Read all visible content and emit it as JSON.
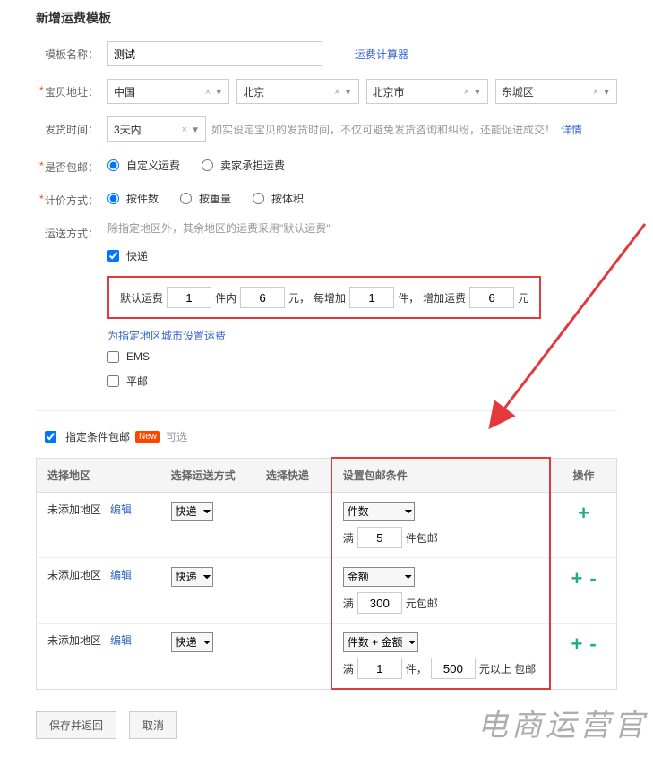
{
  "title": "新增运费模板",
  "fields": {
    "tpl_name_label": "模板名称：",
    "tpl_name_value": "测试",
    "calc_link": "运费计算器",
    "addr_label": "宝贝地址：",
    "addr": {
      "country": "中国",
      "province": "北京",
      "city": "北京市",
      "district": "东城区"
    },
    "ship_time_label": "发货时间：",
    "ship_time_value": "3天内",
    "ship_time_tip": "如实设定宝贝的发货时间，不仅可避免发货咨询和纠纷，还能促进成交！",
    "ship_time_detail": "详情",
    "free_label": "是否包邮：",
    "free_opts": [
      "自定义运费",
      "卖家承担运费"
    ],
    "price_label": "计价方式：",
    "price_opts": [
      "按件数",
      "按重量",
      "按体积"
    ],
    "method_label": "运送方式：",
    "method_tip": "除指定地区外，其余地区的运费采用\"默认运费\"",
    "method_express": "快递",
    "method_ems": "EMS",
    "method_normal": "平邮",
    "default_fee": {
      "label": "默认运费",
      "first_qty": "1",
      "within": "件内",
      "first_price": "6",
      "yuan": "元，",
      "each_add": "每增加",
      "add_qty": "1",
      "piece": "件，",
      "add_fee_label": "增加运费",
      "add_price": "6",
      "yuan2": "元"
    },
    "set_region_link": "为指定地区城市设置运费"
  },
  "conditional": {
    "checkbox_label": "指定条件包邮",
    "badge": "New",
    "opt": "可选",
    "headers": {
      "area": "选择地区",
      "method": "选择运送方式",
      "express": "选择快递",
      "cond": "设置包邮条件",
      "op": "操作"
    },
    "rows": [
      {
        "area": "未添加地区",
        "edit": "编辑",
        "method": "快递",
        "cond_type": "件数",
        "line2_a": "满",
        "line2_val": "5",
        "line2_b": "件包邮",
        "ops": "+"
      },
      {
        "area": "未添加地区",
        "edit": "编辑",
        "method": "快递",
        "cond_type": "金额",
        "line2_a": "满",
        "line2_val": "300",
        "line2_b": "元包邮",
        "ops": "+-"
      },
      {
        "area": "未添加地区",
        "edit": "编辑",
        "method": "快递",
        "cond_type": "件数 + 金额",
        "line2_a": "满",
        "line2_val": "1",
        "line2_mid": "件，",
        "line2_val2": "500",
        "line2_b": "元以上 包邮",
        "ops": "+-"
      }
    ]
  },
  "buttons": {
    "save": "保存并返回",
    "cancel": "取消"
  },
  "watermark": "电商运营官"
}
